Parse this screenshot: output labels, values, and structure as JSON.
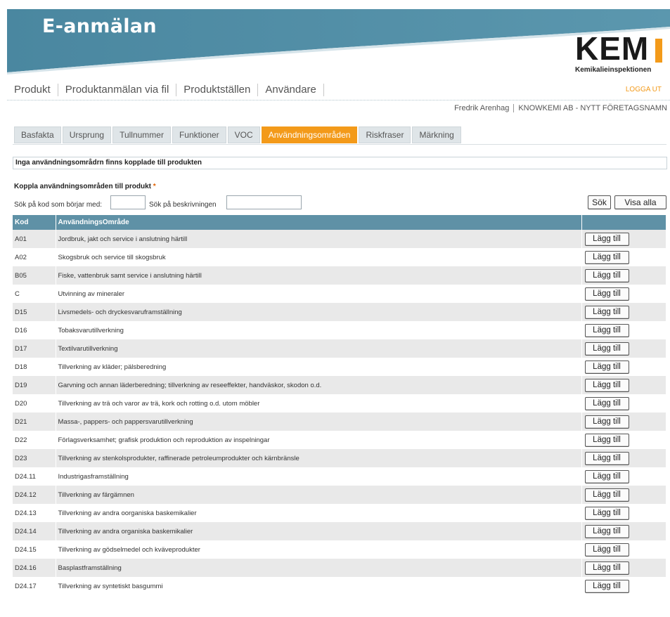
{
  "header": {
    "app_title": "E-anmälan",
    "logo_text": "KEM",
    "logo_subtitle": "Kemikalieinspektionen",
    "colors": {
      "banner": "#4d8aa3",
      "accent": "#f39a1a"
    }
  },
  "topnav": {
    "items": [
      "Produkt",
      "Produktanmälan via fil",
      "Produktställen",
      "Användare"
    ],
    "logout": "LOGGA UT"
  },
  "user": {
    "name": "Fredrik Arenhag",
    "company": "KNOWKEMI AB - NYTT FÖRETAGSNAMN"
  },
  "tabs": {
    "items": [
      "Basfakta",
      "Ursprung",
      "Tullnummer",
      "Funktioner",
      "VOC",
      "Användningsområden",
      "Riskfraser",
      "Märkning"
    ],
    "active": "Användningsområden"
  },
  "message": "Inga användningsområdrn finns kopplade till produkten",
  "section": {
    "label": "Koppla användningsområden till produkt",
    "required_mark": "*"
  },
  "search": {
    "code_label": "Sök på kod som börjar med:",
    "code_value": "",
    "desc_label": "Sök på beskrivningen",
    "desc_value": "",
    "search_button": "Sök",
    "show_all_button": "Visa alla"
  },
  "table": {
    "columns": [
      "Kod",
      "AnvändningsOmråde",
      ""
    ],
    "add_label": "Lägg till",
    "rows": [
      {
        "code": "A01",
        "desc": "Jordbruk, jakt och service i anslutning härtill"
      },
      {
        "code": "A02",
        "desc": "Skogsbruk och service till skogsbruk"
      },
      {
        "code": "B05",
        "desc": "Fiske, vattenbruk samt service i anslutning härtill"
      },
      {
        "code": "C",
        "desc": "Utvinning av mineraler"
      },
      {
        "code": "D15",
        "desc": "Livsmedels- och dryckesvaruframställning"
      },
      {
        "code": "D16",
        "desc": "Tobaksvarutillverkning"
      },
      {
        "code": "D17",
        "desc": "Textilvarutillverkning"
      },
      {
        "code": "D18",
        "desc": "Tillverkning av kläder; pälsberedning"
      },
      {
        "code": "D19",
        "desc": "Garvning och annan läderberedning; tillverkning av reseeffekter, handväskor, skodon o.d."
      },
      {
        "code": "D20",
        "desc": "Tillverkning av trä och varor av trä, kork och rotting o.d. utom möbler"
      },
      {
        "code": "D21",
        "desc": "Massa-, pappers- och pappersvarutillverkning"
      },
      {
        "code": "D22",
        "desc": "Förlagsverksamhet; grafisk produktion och reproduktion av inspelningar"
      },
      {
        "code": "D23",
        "desc": "Tillverkning av stenkolsprodukter, raffinerade petroleumprodukter och kärnbränsle"
      },
      {
        "code": "D24.11",
        "desc": "Industrigasframställning"
      },
      {
        "code": "D24.12",
        "desc": "Tillverkning av färgämnen"
      },
      {
        "code": "D24.13",
        "desc": "Tillverkning av andra oorganiska baskemikalier"
      },
      {
        "code": "D24.14",
        "desc": "Tillverkning av andra organiska baskemikalier"
      },
      {
        "code": "D24.15",
        "desc": "Tillverkning av gödselmedel och kväveprodukter"
      },
      {
        "code": "D24.16",
        "desc": "Basplastframställning"
      },
      {
        "code": "D24.17",
        "desc": "Tillverkning av syntetiskt basgummi"
      }
    ]
  }
}
